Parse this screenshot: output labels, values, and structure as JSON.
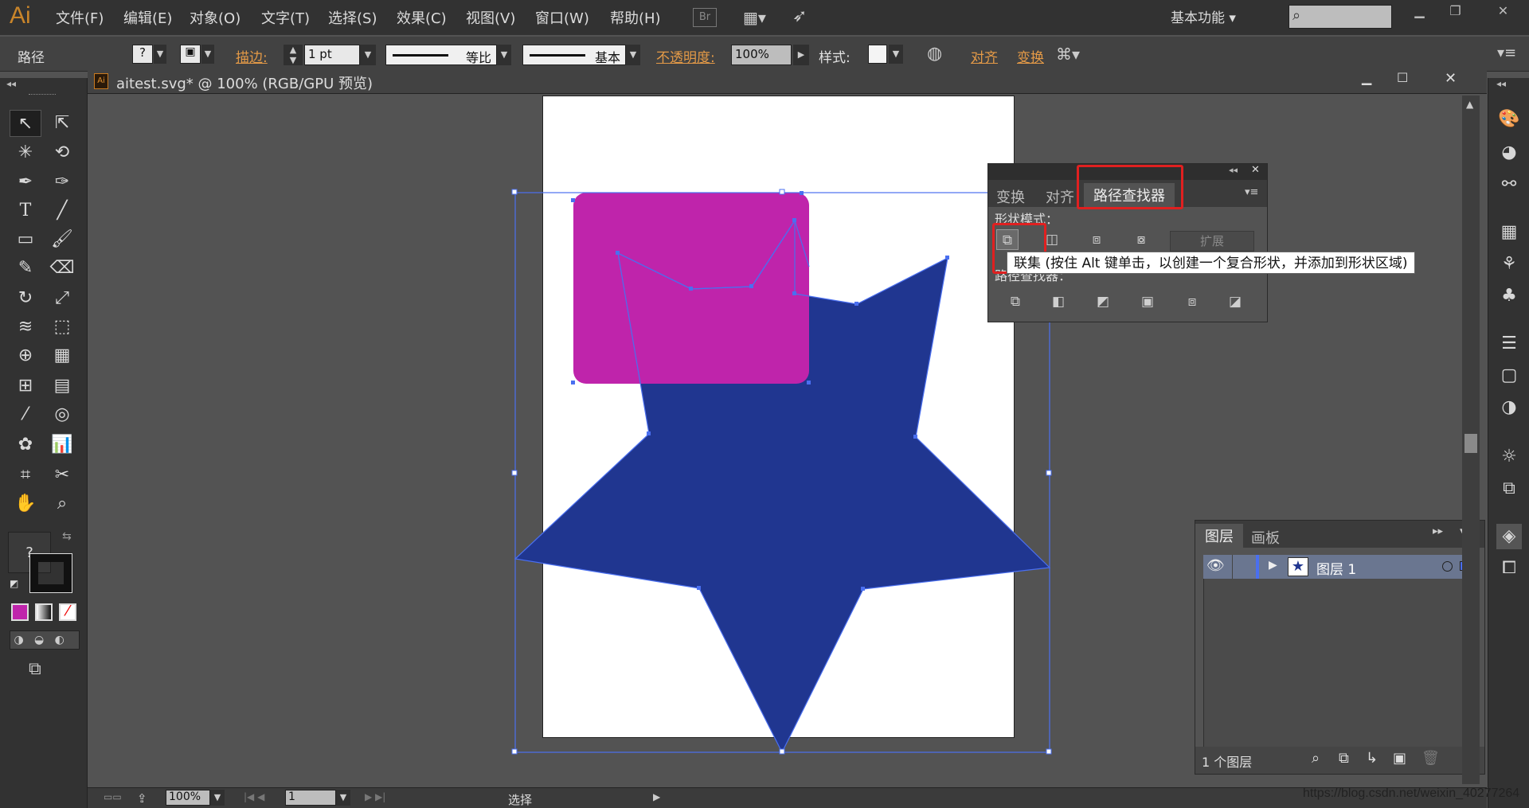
{
  "app": {
    "logo": "Ai",
    "menus": [
      "文件(F)",
      "编辑(E)",
      "对象(O)",
      "文字(T)",
      "选择(S)",
      "效果(C)",
      "视图(V)",
      "窗口(W)",
      "帮助(H)"
    ],
    "bridge": "Br",
    "workspace": "基本功能"
  },
  "control": {
    "selection_type": "路径",
    "stroke_label": "描边:",
    "stroke_weight": "1 pt",
    "profile": "等比",
    "brush": "基本",
    "opacity_label": "不透明度:",
    "opacity_value": "100%",
    "style_label": "样式:",
    "align_label": "对齐",
    "transform_label": "变换"
  },
  "document": {
    "title": "aitest.svg* @ 100% (RGB/GPU 预览)"
  },
  "pathfinder": {
    "tabs": [
      "变换",
      "对齐",
      "路径查找器"
    ],
    "shape_modes_label": "形状模式：",
    "expand_label": "扩展",
    "pathfinders_label": "路径查找器："
  },
  "tooltip": {
    "text": "联集 (按住 Alt 键单击，以创建一个复合形状，并添加到形状区域)"
  },
  "layers": {
    "tabs": [
      "图层",
      "画板"
    ],
    "layer_name": "图层 1",
    "count": "1 个图层"
  },
  "status": {
    "zoom": "100%",
    "artboard_num": "1",
    "tool": "选择"
  },
  "watermark": "https://blog.csdn.net/weixin_40277264",
  "colors": {
    "star_fill": "#203690",
    "rect_fill": "#bf24ab",
    "selection": "#4a6ff0",
    "highlight": "#e02020",
    "ui_dark": "#323232"
  }
}
